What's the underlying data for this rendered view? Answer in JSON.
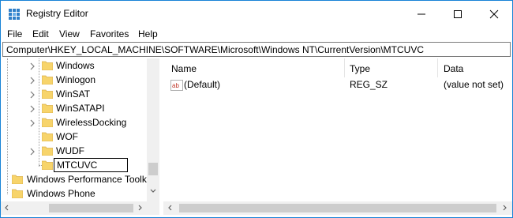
{
  "window": {
    "title": "Registry Editor"
  },
  "menu": [
    "File",
    "Edit",
    "View",
    "Favorites",
    "Help"
  ],
  "address": {
    "path": "Computer\\HKEY_LOCAL_MACHINE\\SOFTWARE\\Microsoft\\Windows NT\\CurrentVersion\\MTCUVC"
  },
  "tree": {
    "items": [
      {
        "label": "Windows",
        "expandable": true
      },
      {
        "label": "Winlogon",
        "expandable": true
      },
      {
        "label": "WinSAT",
        "expandable": true
      },
      {
        "label": "WinSATAPI",
        "expandable": true
      },
      {
        "label": "WirelessDocking",
        "expandable": true
      },
      {
        "label": "WOF",
        "expandable": false
      },
      {
        "label": "WUDF",
        "expandable": true
      },
      {
        "label": "MTCUVC",
        "expandable": false,
        "editing": true
      }
    ],
    "root_items": [
      {
        "label": "Windows Performance Toolk"
      },
      {
        "label": "Windows Phone"
      }
    ]
  },
  "values_pane": {
    "columns": [
      "Name",
      "Type",
      "Data"
    ],
    "rows": [
      {
        "name": "(Default)",
        "type": "REG_SZ",
        "data": "(value not set)",
        "icon": "string-value-icon"
      }
    ]
  },
  "colors": {
    "folder": "#f7d46b",
    "folder_dark": "#dcb04a",
    "border": "#1883d7"
  }
}
